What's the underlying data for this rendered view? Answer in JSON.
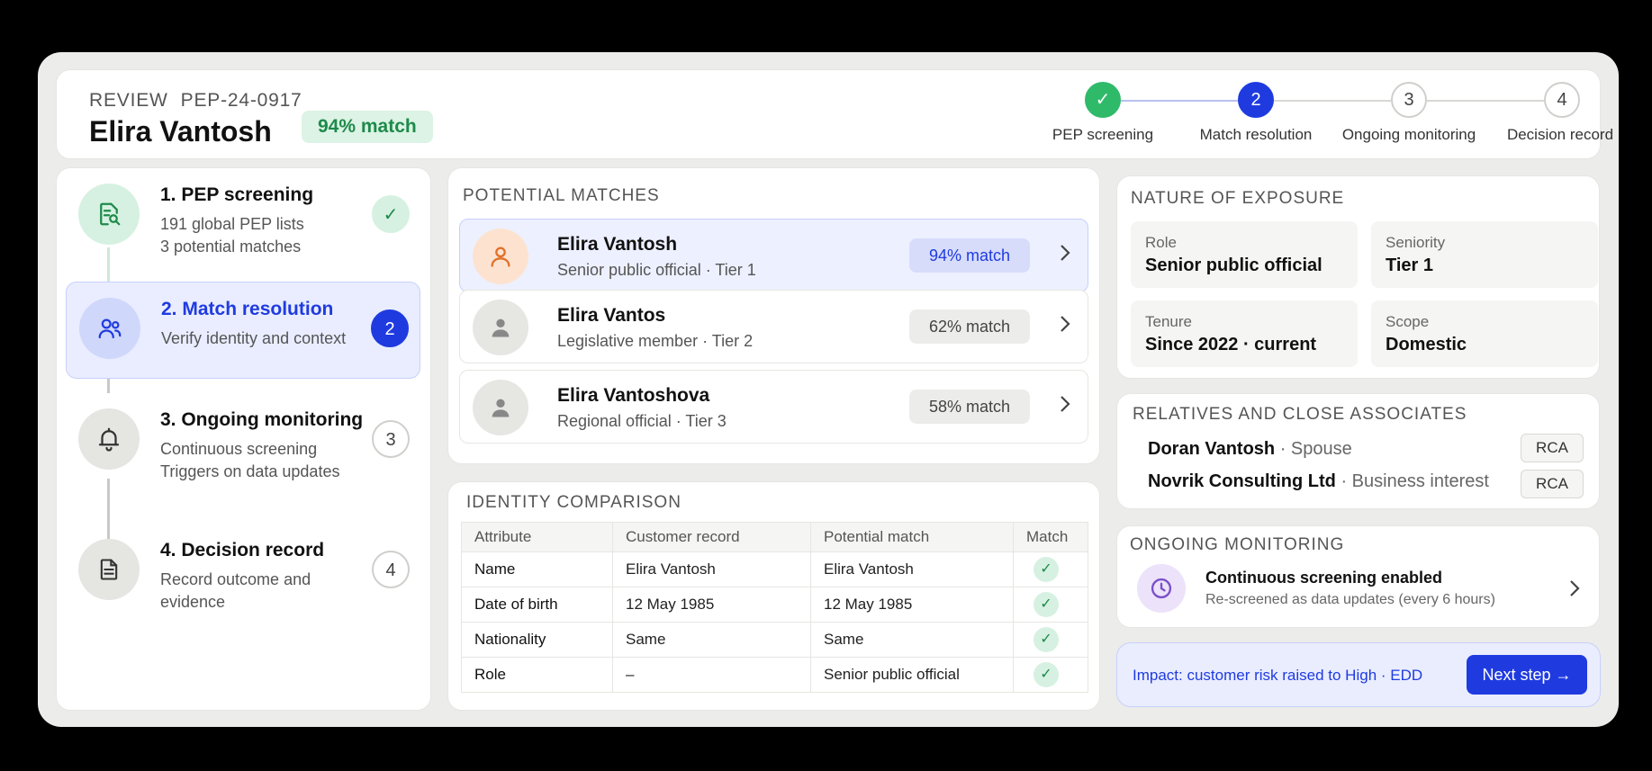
{
  "header": {
    "review_label": "REVIEW",
    "case_id": "PEP-24-0917",
    "customer_name": "Elira Vantosh",
    "match_badge": "94% match"
  },
  "stepper": {
    "steps": [
      {
        "label": "PEP screening",
        "marker": "✓",
        "state": "done"
      },
      {
        "label": "Match resolution",
        "marker": "2",
        "state": "current"
      },
      {
        "label": "Ongoing monitoring",
        "marker": "3",
        "state": "pending"
      },
      {
        "label": "Decision record",
        "marker": "4",
        "state": "pending"
      }
    ]
  },
  "steps_panel": {
    "items": [
      {
        "title": "1. PEP screening",
        "sub1": "191 global PEP lists",
        "sub2": "3 potential matches",
        "badge": "✓",
        "icon": "document-search-icon"
      },
      {
        "title": "2. Match resolution",
        "sub1": "Verify identity and context",
        "sub2": "",
        "badge": "2",
        "icon": "users-icon"
      },
      {
        "title": "3. Ongoing monitoring",
        "sub1": "Continuous screening",
        "sub2": "Triggers on data updates",
        "badge": "3",
        "icon": "bell-icon"
      },
      {
        "title": "4. Decision record",
        "sub1": "Record outcome and",
        "sub2": "evidence",
        "badge": "4",
        "icon": "document-icon"
      }
    ]
  },
  "potential_matches": {
    "title": "POTENTIAL MATCHES",
    "rows": [
      {
        "name": "Elira Vantosh",
        "sub": "Senior public official · Tier 1",
        "match": "94% match"
      },
      {
        "name": "Elira Vantos",
        "sub": "Legislative member · Tier 2",
        "match": "62% match"
      },
      {
        "name": "Elira Vantoshova",
        "sub": "Regional official · Tier 3",
        "match": "58% match"
      }
    ]
  },
  "identity_comparison": {
    "title": "IDENTITY COMPARISON",
    "headers": [
      "Attribute",
      "Customer record",
      "Potential match",
      "Match"
    ],
    "rows": [
      {
        "attr": "Name",
        "customer": "Elira Vantosh",
        "potential": "Elira Vantosh",
        "match": "✓"
      },
      {
        "attr": "Date of birth",
        "customer": "12 May 1985",
        "potential": "12 May 1985",
        "match": "✓"
      },
      {
        "attr": "Nationality",
        "customer": "Same",
        "potential": "Same",
        "match": "✓"
      },
      {
        "attr": "Role",
        "customer": "–",
        "potential": "Senior public official",
        "match": "✓"
      }
    ]
  },
  "nature_of_exposure": {
    "title": "NATURE OF EXPOSURE",
    "tiles": [
      {
        "label": "Role",
        "value": "Senior public official"
      },
      {
        "label": "Seniority",
        "value": "Tier 1"
      },
      {
        "label": "Tenure",
        "value": "Since 2022 · current"
      },
      {
        "label": "Scope",
        "value": "Domestic"
      }
    ]
  },
  "relatives": {
    "title": "RELATIVES AND CLOSE ASSOCIATES",
    "items": [
      {
        "name": "Doran Vantosh",
        "relation": "· Spouse",
        "tag": "RCA"
      },
      {
        "name": "Novrik Consulting Ltd",
        "relation": "· Business interest",
        "tag": "RCA"
      }
    ]
  },
  "ongoing_monitoring": {
    "title": "ONGOING MONITORING",
    "status": "Continuous screening enabled",
    "detail": "Re-screened as data updates (every 6 hours)"
  },
  "impact": {
    "text": "Impact: customer risk raised to High · EDD",
    "button": "Next step →"
  },
  "colors": {
    "accent": "#1f3be0",
    "success": "#2fba6a",
    "success_bg": "#d6f1e1",
    "selected_bg": "#edf0ff"
  }
}
